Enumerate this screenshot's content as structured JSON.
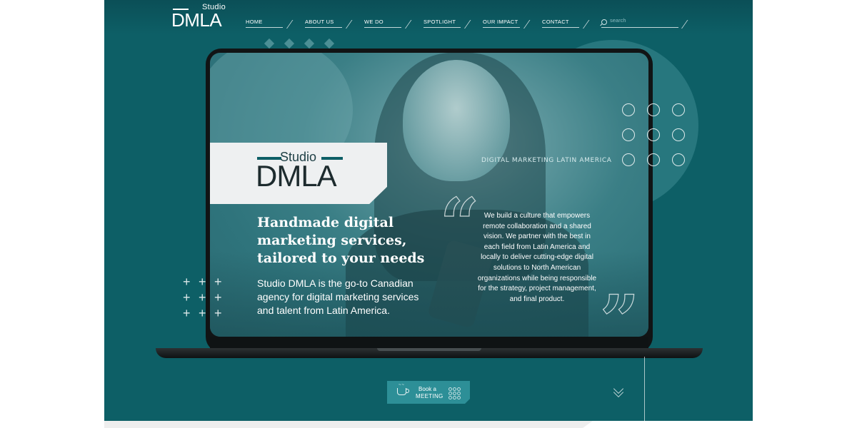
{
  "brand": {
    "studio": "Studio",
    "name": "DMLA"
  },
  "nav": {
    "items": [
      {
        "label": "HOME"
      },
      {
        "label": "ABOUT US"
      },
      {
        "label": "WE DO"
      },
      {
        "label": "SPOTLIGHT"
      },
      {
        "label": "OUR IMPACT"
      },
      {
        "label": "CONTACT"
      }
    ]
  },
  "search": {
    "placeholder": "search"
  },
  "hero": {
    "tagline": "DIGITAL MARKETING LATIN AMERICA",
    "headline": "Handmade digital marketing services, tailored to your needs",
    "subtext": "Studio DMLA is the go-to Canadian agency for digital marketing services and talent from Latin America.",
    "quote": "We build a culture that empowers remote collaboration and a shared vision. We partner with the best in each field from Latin America and locally to deliver cutting-edge digital solutions to North American organizations while being responsible for the strategy, project management, and final product."
  },
  "cta": {
    "line1": "Book a",
    "line2": "MEETING"
  },
  "colors": {
    "background": "#0d5f66",
    "accent": "#2d8f97",
    "card": "#eef0f1"
  }
}
